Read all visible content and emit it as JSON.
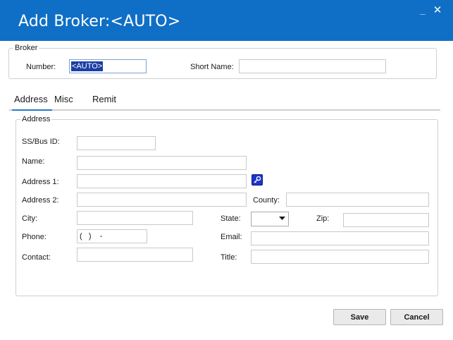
{
  "window": {
    "title": "Add Broker:<AUTO>",
    "minimize_glyph": "_",
    "close_glyph": "✕",
    "accent_color": "#0f6fc6"
  },
  "broker_group": {
    "legend": "Broker",
    "number_label": "Number:",
    "number_value": "<AUTO>",
    "short_name_label": "Short Name:",
    "short_name_value": ""
  },
  "tabs": [
    {
      "label": "Address",
      "active": true
    },
    {
      "label": "Misc",
      "active": false
    },
    {
      "label": "Remit",
      "active": false
    }
  ],
  "address_group": {
    "legend": "Address",
    "ssbus_label": "SS/Bus ID:",
    "name_label": "Name:",
    "address1_label": "Address 1:",
    "address2_label": "Address 2:",
    "county_label": "County:",
    "city_label": "City:",
    "state_label": "State:",
    "zip_label": "Zip:",
    "phone_label": "Phone:",
    "phone_value": "(   )    -",
    "email_label": "Email:",
    "contact_label": "Contact:",
    "title_label": "Title:",
    "lookup_icon": "key-icon"
  },
  "buttons": {
    "save": "Save",
    "cancel": "Cancel"
  }
}
